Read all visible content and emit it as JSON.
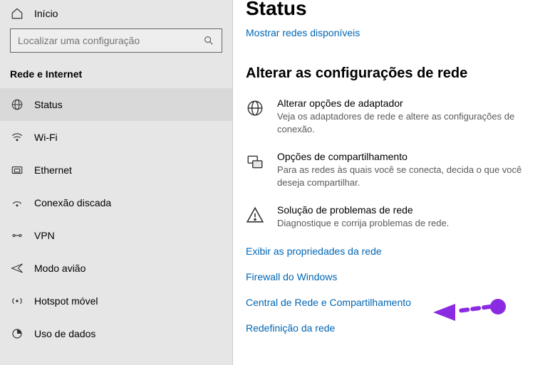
{
  "sidebar": {
    "home": "Início",
    "search_placeholder": "Localizar uma configuração",
    "category": "Rede e Internet",
    "items": [
      {
        "label": "Status"
      },
      {
        "label": "Wi-Fi"
      },
      {
        "label": "Ethernet"
      },
      {
        "label": "Conexão discada"
      },
      {
        "label": "VPN"
      },
      {
        "label": "Modo avião"
      },
      {
        "label": "Hotspot móvel"
      },
      {
        "label": "Uso de dados"
      }
    ]
  },
  "main": {
    "title": "Status",
    "show_networks_link": "Mostrar redes disponíveis",
    "section_title": "Alterar as configurações de rede",
    "options": [
      {
        "title": "Alterar opções de adaptador",
        "desc": "Veja os adaptadores de rede e altere as configurações de conexão."
      },
      {
        "title": "Opções de compartilhamento",
        "desc": "Para as redes às quais você se conecta, decida o que você deseja compartilhar."
      },
      {
        "title": "Solução de problemas de rede",
        "desc": "Diagnostique e corrija problemas de rede."
      }
    ],
    "links": [
      "Exibir as propriedades da rede",
      "Firewall do Windows",
      "Central de Rede e Compartilhamento",
      "Redefinição da rede"
    ]
  }
}
